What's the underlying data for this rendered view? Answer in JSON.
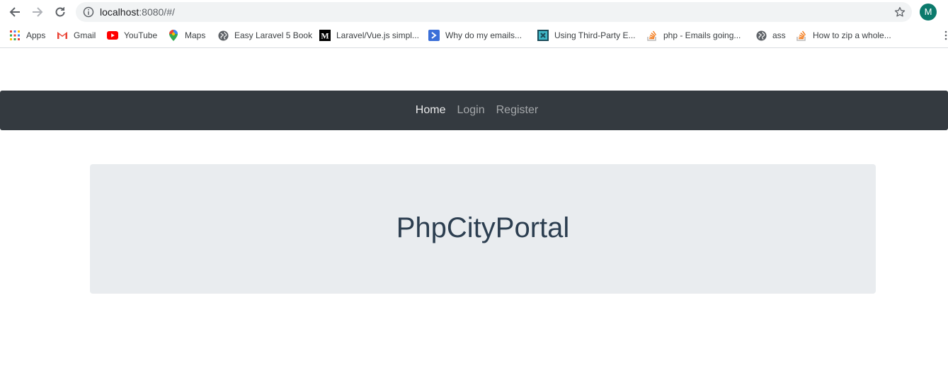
{
  "browser": {
    "url_host": "localhost",
    "url_rest": ":8080/#/",
    "avatar_letter": "M",
    "bookmarks": [
      {
        "label": "Apps",
        "icon": "apps-grid-icon"
      },
      {
        "label": "Gmail",
        "icon": "gmail-icon"
      },
      {
        "label": "YouTube",
        "icon": "youtube-icon"
      },
      {
        "label": "Maps",
        "icon": "maps-pin-icon"
      },
      {
        "label": "Easy Laravel 5 Book",
        "icon": "globe-icon"
      },
      {
        "label": "Laravel/Vue.js simpl...",
        "icon": "medium-icon"
      },
      {
        "label": "Why do my emails...",
        "icon": "arrow-app-icon"
      },
      {
        "label": "Using Third-Party E...",
        "icon": "puzzle-site-icon"
      },
      {
        "label": "php - Emails going...",
        "icon": "stackoverflow-icon"
      },
      {
        "label": "ass",
        "icon": "globe-icon"
      },
      {
        "label": "How to zip a whole...",
        "icon": "stackoverflow-icon"
      }
    ]
  },
  "navbar": {
    "links": [
      "Home",
      "Login",
      "Register"
    ]
  },
  "jumbotron": {
    "title": "PhpCityPortal"
  },
  "colors": {
    "navbar_bg": "#343a40",
    "jumbotron_bg": "#e9ecef",
    "title_color": "#2c3e50"
  }
}
